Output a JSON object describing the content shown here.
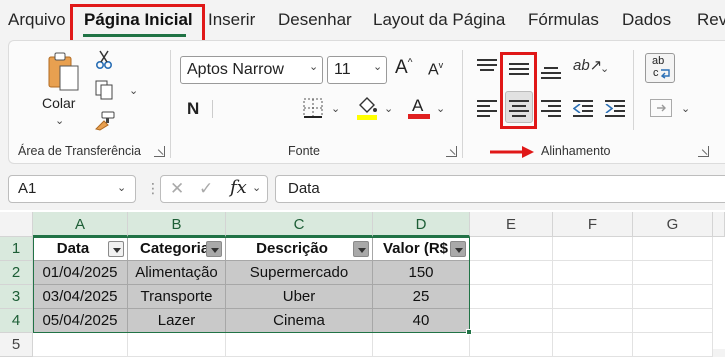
{
  "tabs": [
    "Arquivo",
    "Página Inicial",
    "Inserir",
    "Desenhar",
    "Layout da Página",
    "Fórmulas",
    "Dados",
    "Revi"
  ],
  "clipboard": {
    "paste_label": "Colar",
    "group_label": "Área de Transferência"
  },
  "font": {
    "name": "Aptos Narrow",
    "size": "11",
    "bold_label": "N",
    "group_label": "Fonte",
    "fill_color": "#ffff00",
    "font_color": "#e02020"
  },
  "alignment": {
    "group_label": "Alinhamento"
  },
  "formula_bar": {
    "name_box": "A1",
    "fx_label": "fx",
    "content": "Data"
  },
  "grid": {
    "columns": [
      "A",
      "B",
      "C",
      "D",
      "E",
      "F",
      "G"
    ],
    "rows": [
      "1",
      "2",
      "3",
      "4",
      "5"
    ],
    "headers": [
      "Data",
      "Categoria",
      "Descrição",
      "Valor (R$"
    ],
    "data": [
      [
        "01/04/2025",
        "Alimentação",
        "Supermercado",
        "150"
      ],
      [
        "03/04/2025",
        "Transporte",
        "Uber",
        "25"
      ],
      [
        "05/04/2025",
        "Lazer",
        "Cinema",
        "40"
      ]
    ]
  },
  "colors": {
    "accent": "#217346",
    "highlight": "#e01818"
  }
}
